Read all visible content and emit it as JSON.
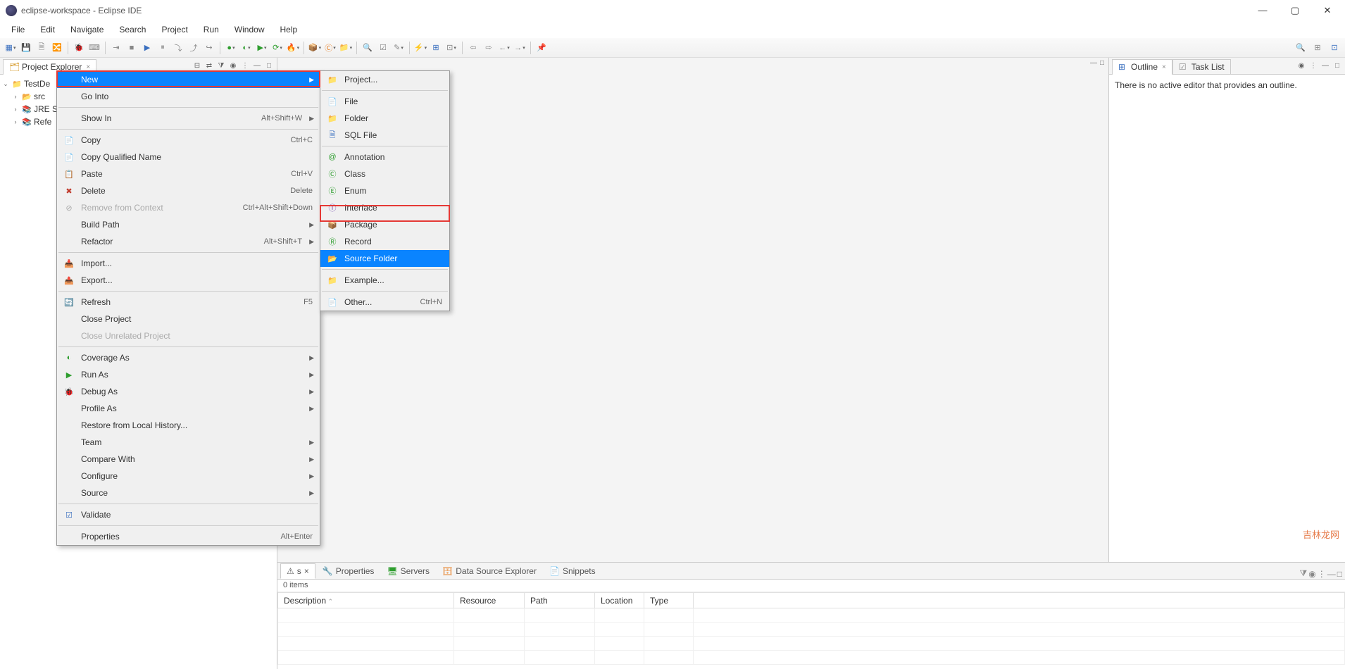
{
  "window": {
    "title": "eclipse-workspace - Eclipse IDE"
  },
  "menubar": [
    "File",
    "Edit",
    "Navigate",
    "Search",
    "Project",
    "Run",
    "Window",
    "Help"
  ],
  "project_explorer": {
    "title": "Project Explorer",
    "nodes": {
      "root": "TestDe",
      "child1": "src",
      "child2": "JRE S",
      "child3": "Refe"
    }
  },
  "outline": {
    "title": "Outline",
    "message": "There is no active editor that provides an outline."
  },
  "tasklist": {
    "title": "Task List"
  },
  "bottom": {
    "items_label": "0 items",
    "tabs": {
      "markers": "",
      "properties": "Properties",
      "servers": "Servers",
      "dse": "Data Source Explorer",
      "snippets": "Snippets",
      "partial": "s"
    },
    "columns": {
      "description": "Description",
      "resource": "Resource",
      "path": "Path",
      "location": "Location",
      "type": "Type"
    }
  },
  "context_menu": {
    "new": {
      "label": "New"
    },
    "go_into": {
      "label": "Go Into"
    },
    "show_in": {
      "label": "Show In",
      "shortcut": "Alt+Shift+W"
    },
    "copy": {
      "label": "Copy",
      "shortcut": "Ctrl+C"
    },
    "copy_qn": {
      "label": "Copy Qualified Name"
    },
    "paste": {
      "label": "Paste",
      "shortcut": "Ctrl+V"
    },
    "delete": {
      "label": "Delete",
      "shortcut": "Delete"
    },
    "remove_ctx": {
      "label": "Remove from Context",
      "shortcut": "Ctrl+Alt+Shift+Down"
    },
    "build_path": {
      "label": "Build Path"
    },
    "refactor": {
      "label": "Refactor",
      "shortcut": "Alt+Shift+T"
    },
    "import": {
      "label": "Import..."
    },
    "export": {
      "label": "Export..."
    },
    "refresh": {
      "label": "Refresh",
      "shortcut": "F5"
    },
    "close_proj": {
      "label": "Close Project"
    },
    "close_unrel": {
      "label": "Close Unrelated Project"
    },
    "coverage": {
      "label": "Coverage As"
    },
    "run_as": {
      "label": "Run As"
    },
    "debug_as": {
      "label": "Debug As"
    },
    "profile_as": {
      "label": "Profile As"
    },
    "restore": {
      "label": "Restore from Local History..."
    },
    "team": {
      "label": "Team"
    },
    "compare": {
      "label": "Compare With"
    },
    "configure": {
      "label": "Configure"
    },
    "source": {
      "label": "Source"
    },
    "validate": {
      "label": "Validate"
    },
    "properties": {
      "label": "Properties",
      "shortcut": "Alt+Enter"
    }
  },
  "new_submenu": {
    "project": {
      "label": "Project..."
    },
    "file": {
      "label": "File"
    },
    "folder": {
      "label": "Folder"
    },
    "sql": {
      "label": "SQL File"
    },
    "annotation": {
      "label": "Annotation"
    },
    "class": {
      "label": "Class"
    },
    "enum": {
      "label": "Enum"
    },
    "interface": {
      "label": "Interface"
    },
    "package": {
      "label": "Package"
    },
    "record": {
      "label": "Record"
    },
    "source_folder": {
      "label": "Source Folder"
    },
    "example": {
      "label": "Example..."
    },
    "other": {
      "label": "Other...",
      "shortcut": "Ctrl+N"
    }
  },
  "watermark": "吉林龙网"
}
